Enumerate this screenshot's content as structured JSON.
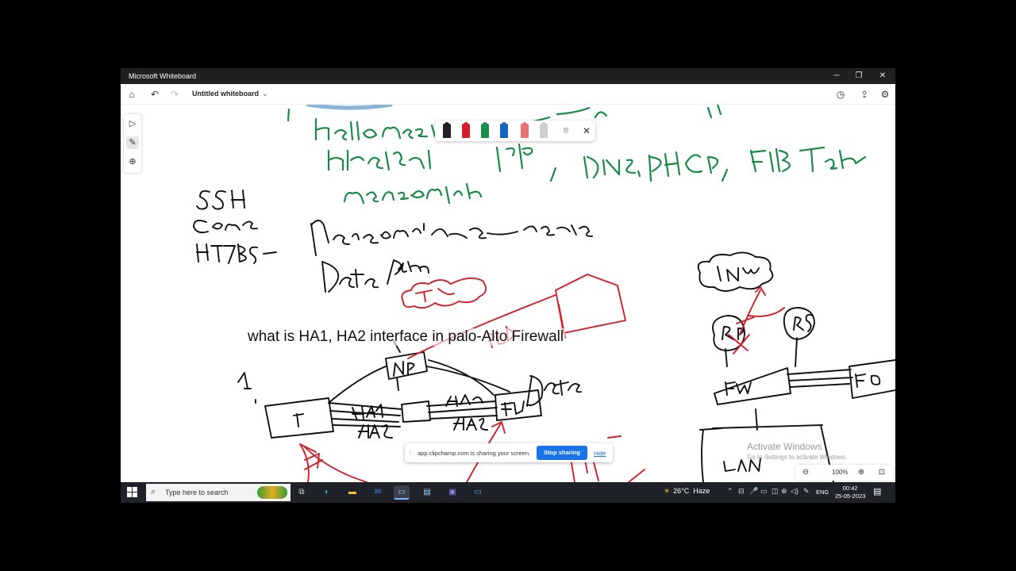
{
  "window": {
    "title": "Microsoft Whiteboard",
    "minimize_glyph": "─",
    "maximize_glyph": "❐",
    "close_glyph": "✕"
  },
  "toolbar": {
    "board_title": "Untitled whiteboard",
    "home_icon": "⌂",
    "undo_icon": "↶",
    "redo_icon": "↷",
    "chevron": "⌄",
    "timer_icon": "◷",
    "share_icon": "⇪",
    "settings_icon": "⚙"
  },
  "left_rail": {
    "select_icon": "▷",
    "pen_icon": "✎",
    "add_icon": "⊕"
  },
  "pen_tray": {
    "pens": [
      {
        "name": "black",
        "color": "#222222"
      },
      {
        "name": "red",
        "color": "#d21f2b"
      },
      {
        "name": "green",
        "color": "#1a8c4a"
      },
      {
        "name": "blue",
        "color": "#1565c0"
      },
      {
        "name": "highlighter-red",
        "color": "#e57373"
      },
      {
        "name": "eraser",
        "color": "#cfcfcf"
      }
    ],
    "lasso_icon": "⌾",
    "close_icon": "✕"
  },
  "caption": "what is HA1, HA2 interface in palo-Alto Firewall",
  "screen_share": {
    "grip": "⁞",
    "message": "app.clipchamp.com is sharing your screen.",
    "stop_label": "Stop sharing",
    "hide_label": "Hide"
  },
  "watermark": {
    "line1": "Activate Windows",
    "line2": "Go to Settings to activate Windows."
  },
  "zoom": {
    "zoom_out_icon": "⊖",
    "value": "100%",
    "zoom_in_icon": "⊕",
    "fit_icon": "⊡"
  },
  "taskbar": {
    "search_icon": "⌕",
    "search_placeholder": "Type here to search",
    "apps": [
      {
        "name": "task-view",
        "glyph": "⧉",
        "color": "#dddddd"
      },
      {
        "name": "edge",
        "glyph": "◐",
        "color": "#2bb6e8"
      },
      {
        "name": "file-explorer",
        "glyph": "▬",
        "color": "#f3c33a"
      },
      {
        "name": "mail",
        "glyph": "✉",
        "color": "#3b8fe0"
      },
      {
        "name": "whiteboard",
        "glyph": "▭",
        "color": "#8fc3ff"
      },
      {
        "name": "notepad",
        "glyph": "▤",
        "color": "#9ad2ff"
      },
      {
        "name": "teams",
        "glyph": "▣",
        "color": "#8e84e8"
      },
      {
        "name": "remote-desktop",
        "glyph": "▭",
        "color": "#4ea3e8"
      }
    ],
    "weather": {
      "icon": "☀",
      "temp": "26°C",
      "condition": "Haze"
    },
    "tray_icons": [
      "⌃",
      "⊟",
      "🎤",
      "▭",
      "◫",
      "⊕",
      "◁)",
      "✎"
    ],
    "language": "ENG",
    "time": "00:42",
    "date": "25-05-2023",
    "notification_icon": "▤"
  }
}
